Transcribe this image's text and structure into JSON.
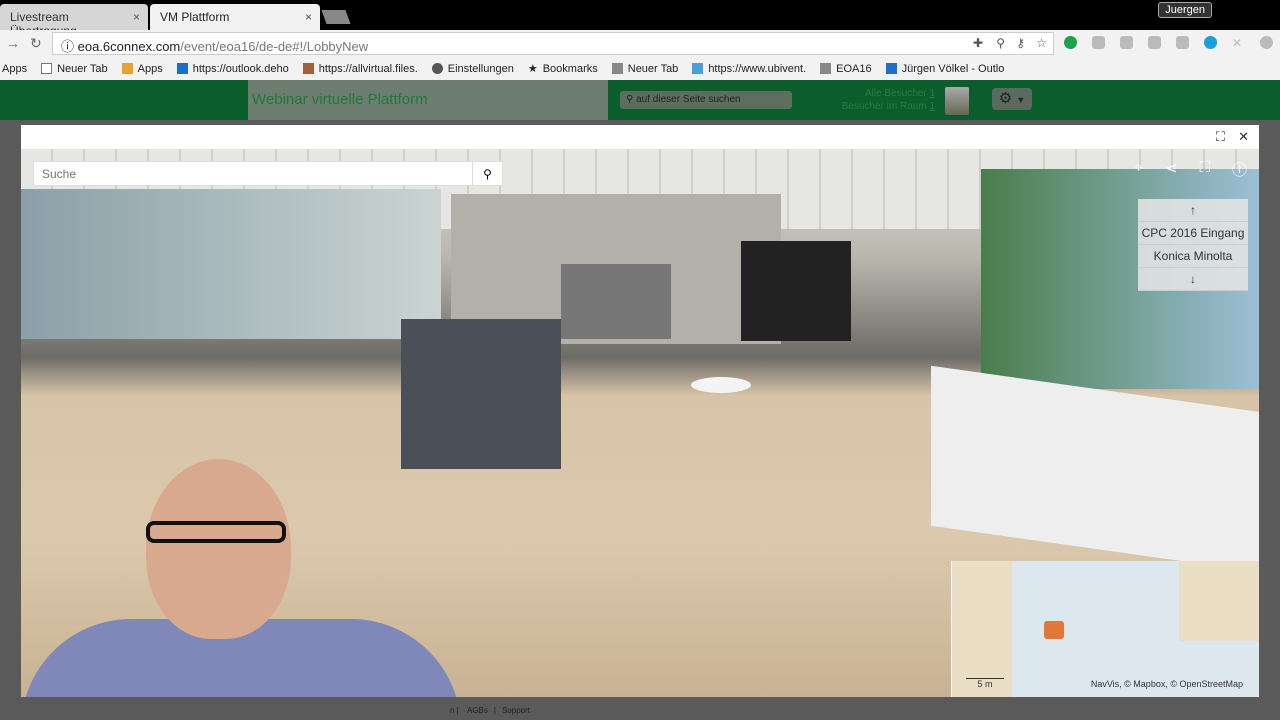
{
  "browser": {
    "tabs": [
      {
        "label": "Livestream Übertragung",
        "active": false
      },
      {
        "label": "VM Plattform",
        "active": true
      }
    ],
    "profile": "Juergen",
    "url_host": "eoa.6connex.com",
    "url_path": "/event/eoa16/de-de#!/LobbyNew",
    "bookmarks": [
      "Apps",
      "Neuer Tab",
      "Apps",
      "https://outlook.deho",
      "https://allvirtual.files.",
      "Einstellungen",
      "Bookmarks",
      "Neuer Tab",
      "https://www.ubivent.",
      "EOA16",
      "Jürgen Völkel - Outlo"
    ]
  },
  "site": {
    "title": "Webinar virtuelle Plattform",
    "search_placeholder": "auf dieser Seite suchen",
    "all_visitors_label": "Alle Besucher",
    "all_visitors": "1",
    "room_visitors_label": "Besucher im Raum",
    "room_visitors": "1"
  },
  "viewer": {
    "search_placeholder": "Suche",
    "scenes": [
      "CPC 2016 Eingang",
      "Konica Minolta"
    ],
    "map_scale": "5 m",
    "map_attribution": "NavVis, © Mapbox, © OpenStreetMap"
  },
  "footer": {
    "links": [
      "AGBs",
      "Support"
    ],
    "partial": "n"
  }
}
